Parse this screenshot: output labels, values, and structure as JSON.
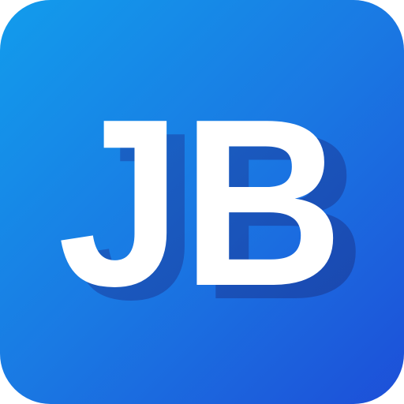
{
  "icon": {
    "monogram": "JB",
    "colors": {
      "gradient_start": "#129cec",
      "gradient_mid": "#1a79e3",
      "gradient_end": "#1d4fd8",
      "letter": "#ffffff",
      "shadow": "#1a4bb0"
    }
  }
}
